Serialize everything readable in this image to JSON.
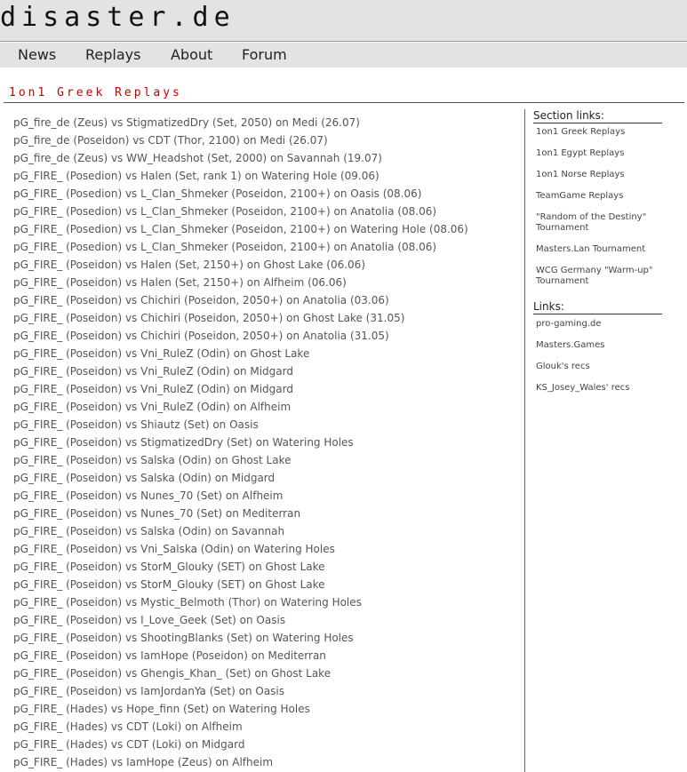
{
  "header": {
    "logo": "disaster.de"
  },
  "nav": {
    "items": [
      "News",
      "Replays",
      "About",
      "Forum"
    ]
  },
  "page": {
    "title": "1on1 Greek Replays"
  },
  "replays": [
    "pG_fire_de (Zeus) vs StigmatizedDry (Set, 2050) on Medi (26.07)",
    "pG_fire_de (Poseidon) vs CDT (Thor, 2100) on Medi (26.07)",
    "pG_fire_de (Zeus) vs WW_Headshot (Set, 2000) on Savannah (19.07)",
    "pG_FIRE_ (Posedion) vs Halen (Set, rank 1) on Watering Hole (09.06)",
    "pG_FIRE_ (Posedion) vs L_Clan_Shmeker (Poseidon, 2100+) on Oasis (08.06)",
    "pG_FIRE_ (Posedion) vs L_Clan_Shmeker (Poseidon, 2100+) on Anatolia (08.06)",
    "pG_FIRE_ (Posedion) vs L_Clan_Shmeker (Poseidon, 2100+) on Watering Hole (08.06)",
    "pG_FIRE_ (Posedion) vs L_Clan_Shmeker (Poseidon, 2100+) on Anatolia (08.06)",
    "pG_FIRE_ (Poseidon) vs Halen (Set, 2150+) on Ghost Lake (06.06)",
    "pG_FIRE_ (Poseidon) vs Halen (Set, 2150+) on Alfheim (06.06)",
    "pG_FIRE_ (Poseidon) vs Chichiri (Poseidon, 2050+) on Anatolia (03.06)",
    "pG_FIRE_ (Poseidon) vs Chichiri (Poseidon, 2050+) on Ghost Lake (31.05)",
    "pG_FIRE_ (Poseidon) vs Chichiri (Poseidon, 2050+) on Anatolia (31.05)",
    "pG_FIRE_ (Poseidon) vs Vni_RuleZ (Odin) on Ghost Lake",
    "pG_FIRE_ (Poseidon) vs Vni_RuleZ (Odin) on Midgard",
    "pG_FIRE_ (Poseidon) vs Vni_RuleZ (Odin) on Midgard",
    "pG_FIRE_ (Poseidon) vs Vni_RuleZ (Odin) on Alfheim",
    "pG_FIRE_ (Poseidon) vs Shiautz (Set) on Oasis",
    "pG_FIRE_ (Poseidon) vs StigmatizedDry (Set) on Watering Holes",
    "pG_FIRE_ (Poseidon) vs Salska (Odin) on Ghost Lake",
    "pG_FIRE_ (Poseidon) vs Salska (Odin) on Midgard",
    "pG_FIRE_ (Poseidon) vs Nunes_70 (Set) on Alfheim",
    "pG_FIRE_ (Poseidon) vs Nunes_70 (Set) on Mediterran",
    "pG_FIRE_ (Poseidon) vs Salska (Odin) on Savannah",
    "pG_FIRE_ (Poseidon) vs Vni_Salska (Odin) on Watering Holes",
    "pG_FIRE_ (Poseidon) vs StorM_Glouky (SET) on Ghost Lake",
    "pG_FIRE_ (Poseidon) vs StorM_Glouky (SET) on Ghost Lake",
    "pG_FIRE_ (Poseidon) vs Mystic_Belmoth (Thor) on Watering Holes",
    "pG_FIRE_ (Poseidon) vs I_Love_Geek (Set) on Oasis",
    "pG_FIRE_ (Poseidon) vs ShootingBlanks (Set) on Watering Holes",
    "pG_FIRE_ (Poseidon) vs IamHope (Poseidon) on Mediterran",
    "pG_FIRE_ (Poseidon) vs Ghengis_Khan_ (Set) on Ghost Lake",
    "pG_FIRE_ (Poseidon) vs IamJordanYa (Set) on Oasis",
    "pG_FIRE_ (Hades) vs Hope_finn (Set) on Watering Holes",
    "pG_FIRE_ (Hades) vs CDT (Loki) on Alfheim",
    "pG_FIRE_ (Hades) vs CDT (Loki) on Midgard",
    "pG_FIRE_ (Hades) vs IamHope (Zeus) on Alfheim"
  ],
  "sidebar": {
    "section_heading": "Section links:",
    "section_links": [
      "1on1 Greek Replays",
      "1on1 Egypt Replays",
      "1on1 Norse Replays",
      "TeamGame Replays",
      "\"Random of the Destiny\" Tournament",
      "Masters.Lan Tournament",
      "WCG Germany \"Warm-up\" Tournament"
    ],
    "links_heading": "Links:",
    "links": [
      "pro-gaming.de",
      "Masters.Games",
      "Glouk's recs",
      "KS_Josey_Wales' recs"
    ]
  }
}
